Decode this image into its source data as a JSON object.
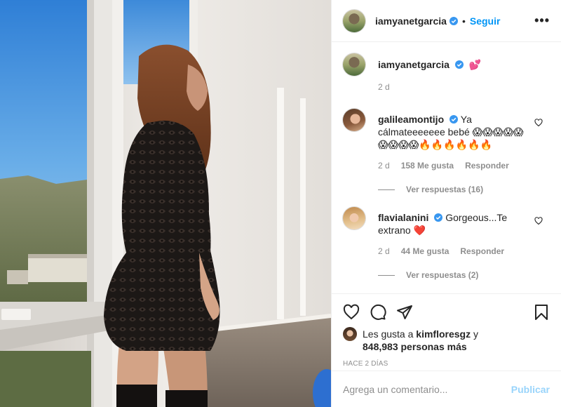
{
  "post": {
    "username": "iamyanetgarcia",
    "follow_label": "Seguir",
    "separator": "•",
    "more_label": "•••",
    "caption": {
      "username": "iamyanetgarcia",
      "text": "💕",
      "age": "2 d"
    }
  },
  "comments": [
    {
      "username": "galileamontijo",
      "text": "Ya cálmateeeeeee bebé 😱😱😱😱😱😱😱😱😱🔥🔥🔥🔥🔥🔥",
      "age": "2 d",
      "likes": "158 Me gusta",
      "reply_label": "Responder",
      "view_replies": "Ver respuestas (16)"
    },
    {
      "username": "flavialanini",
      "text": "Gorgeous...Te extrano ❤️",
      "age": "2 d",
      "likes": "44 Me gusta",
      "reply_label": "Responder",
      "view_replies": "Ver respuestas (2)"
    }
  ],
  "likes": {
    "prefix": "Les gusta a",
    "user": "kimfloresgz",
    "conj": "y",
    "others": "848,983 personas más"
  },
  "timestamp": "HACE 2 DÍAS",
  "add_comment": {
    "placeholder": "Agrega un comentario...",
    "publish_label": "Publicar"
  },
  "colors": {
    "link_blue": "#0095f6",
    "verified_blue": "#3897f0",
    "muted": "#8e8e8e",
    "text": "#262626"
  },
  "icons": [
    "verified-badge-icon",
    "heart-icon",
    "comment-icon",
    "share-icon",
    "bookmark-icon",
    "more-icon"
  ]
}
